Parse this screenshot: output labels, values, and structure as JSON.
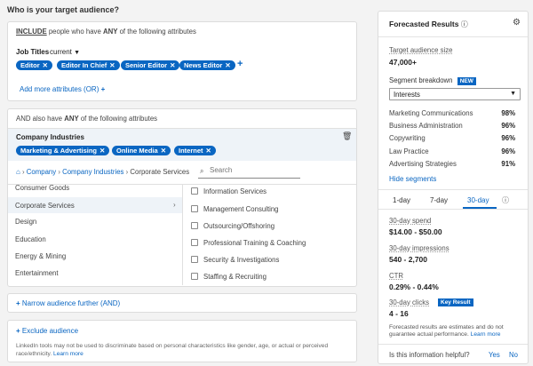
{
  "heading": "Who is your target audience?",
  "include_box": {
    "prefix": "INCLUDE",
    "text": " people who have ",
    "any": "ANY",
    "suffix": " of the following attributes",
    "job_titles_label": "Job Titles",
    "job_titles_mode": "current",
    "pills": [
      "Editor",
      "Editor In Chief",
      "Senior Editor",
      "News Editor"
    ],
    "add_more": "Add more attributes (OR)"
  },
  "and_box": {
    "prefix": "AND",
    "text": " also have ",
    "any": "ANY",
    "suffix": " of the following attributes",
    "category": "Company Industries",
    "pills": [
      "Marketing & Advertising",
      "Online Media",
      "Internet"
    ],
    "breadcrumb": [
      "Company",
      "Company Industries",
      "Corporate Services"
    ],
    "search_placeholder": "Search",
    "left_list": [
      "Consumer Goods",
      "Corporate Services",
      "Design",
      "Education",
      "Energy & Mining",
      "Entertainment"
    ],
    "right_list": [
      "Information Services",
      "Management Consulting",
      "Outsourcing/Offshoring",
      "Professional Training & Coaching",
      "Security & Investigations",
      "Staffing & Recruiting"
    ]
  },
  "narrow": "Narrow audience further (AND)",
  "exclude": {
    "label": "Exclude audience",
    "disclaimer": "LinkedIn tools may not be used to discriminate based on personal characteristics like gender, age, or actual or perceived race/ethnicity.",
    "learn_more": "Learn more"
  },
  "forecast": {
    "title": "Forecasted Results",
    "target_label": "Target audience size",
    "target_value": "47,000+",
    "segment_label": "Segment breakdown",
    "new_badge": "NEW",
    "dropdown_value": "Interests",
    "segments": [
      {
        "name": "Marketing Communications",
        "pct": "98%"
      },
      {
        "name": "Business Administration",
        "pct": "96%"
      },
      {
        "name": "Copywriting",
        "pct": "96%"
      },
      {
        "name": "Law Practice",
        "pct": "96%"
      },
      {
        "name": "Advertising Strategies",
        "pct": "91%"
      }
    ],
    "hide_segments": "Hide segments",
    "tabs": [
      "1-day",
      "7-day",
      "30-day"
    ],
    "active_tab": "30-day",
    "stats": [
      {
        "label": "30-day spend",
        "value": "$14.00 - $50.00"
      },
      {
        "label": "30-day impressions",
        "value": "540 - 2,700"
      },
      {
        "label": "CTR",
        "value": "0.29% - 0.44%"
      },
      {
        "label": "30-day clicks",
        "value": "4 - 16"
      }
    ],
    "key_result": "Key Result",
    "footnote": "Forecasted results are estimates and do not guarantee actual performance.",
    "footnote_link": "Learn more",
    "helpful_q": "Is this information helpful?",
    "yes": "Yes",
    "no": "No"
  },
  "colors": {
    "accent": "#0a66c2",
    "badge_blue": "#0a66c2"
  }
}
